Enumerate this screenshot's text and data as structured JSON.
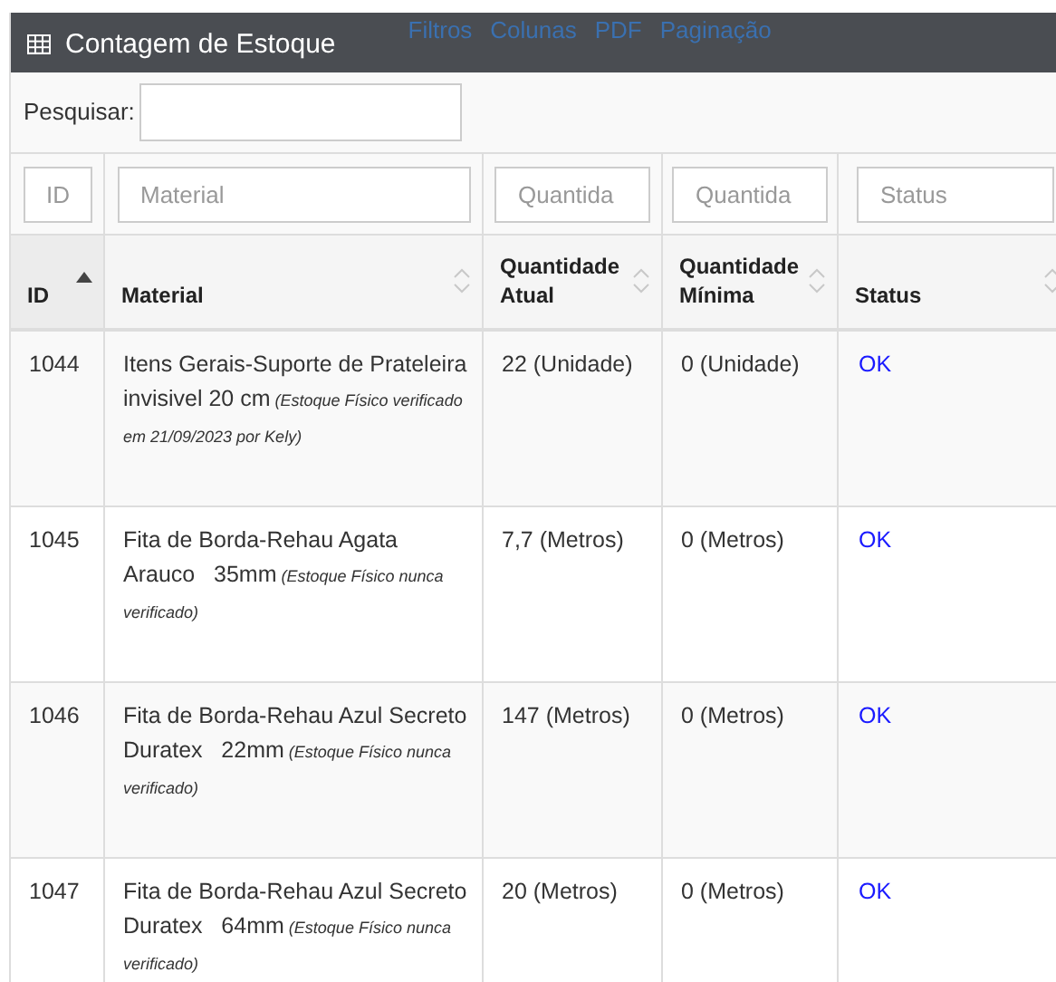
{
  "panel": {
    "title": "Contagem de Estoque",
    "links": [
      "Filtros",
      "Colunas",
      "PDF",
      "Paginação"
    ]
  },
  "search": {
    "label": "Pesquisar:"
  },
  "filters": [
    {
      "placeholder": "ID"
    },
    {
      "placeholder": "Material"
    },
    {
      "placeholder": "Quantida"
    },
    {
      "placeholder": "Quantida"
    },
    {
      "placeholder": "Status"
    }
  ],
  "table": {
    "columns": [
      {
        "label": "ID",
        "sorted": true
      },
      {
        "label": "Material",
        "sorted": false
      },
      {
        "label": "Quantidade Atual",
        "sorted": false
      },
      {
        "label": "Quantidade Mínima",
        "sorted": false
      },
      {
        "label": "Status",
        "sorted": false
      }
    ],
    "rows": [
      {
        "id": "1044",
        "material": "Itens Gerais-Suporte de Prateleira invisivel 20 cm",
        "note": " (Estoque Físico verificado em 21/09/2023 por Kely)",
        "current": "22 (Unidade)",
        "minimum": "0 (Unidade)",
        "status": "OK"
      },
      {
        "id": "1045",
        "material": "Fita de Borda-Rehau Agata Arauco   35mm",
        "note": " (Estoque Físico nunca verificado)",
        "current": "7,7 (Metros)",
        "minimum": "0 (Metros)",
        "status": "OK"
      },
      {
        "id": "1046",
        "material": "Fita de Borda-Rehau Azul Secreto Duratex   22mm",
        "note": " (Estoque Físico nunca verificado)",
        "current": "147 (Metros)",
        "minimum": "0 (Metros)",
        "status": "OK"
      },
      {
        "id": "1047",
        "material": "Fita de Borda-Rehau Azul Secreto Duratex   64mm",
        "note": " (Estoque Físico nunca verificado)",
        "current": "20 (Metros)",
        "minimum": "0 (Metros)",
        "status": "OK"
      }
    ]
  }
}
